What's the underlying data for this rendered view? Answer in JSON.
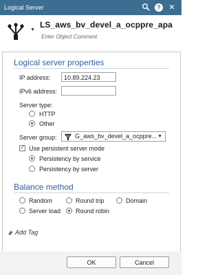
{
  "window": {
    "title": "Logical Server"
  },
  "header": {
    "object_name": "LS_aws_bv_devel_a_ocppre_apa",
    "comment_placeholder": "Enter Object Comment"
  },
  "properties": {
    "section_title": "Logical server properties",
    "ip_label": "IP address:",
    "ip_value": "10.89.224.23",
    "ipv6_label": "IPv6 address:",
    "ipv6_value": "",
    "server_type_label": "Server type:",
    "server_type_options": [
      "HTTP",
      "Other"
    ],
    "server_type_selected": "Other",
    "server_group_label": "Server group:",
    "server_group_value": "G_aws_bv_devel_a_ocppre...",
    "persistent_label": "Use persistent server mode",
    "persistent_checked": true,
    "persistency_options": [
      "Persistency by service",
      "Persistency by server"
    ],
    "persistency_selected": "Persistency by service"
  },
  "balance": {
    "section_title": "Balance method",
    "options": [
      "Random",
      "Round trip",
      "Domain",
      "Server load",
      "Round robin"
    ],
    "selected": "Round robin"
  },
  "tags": {
    "add_label": "Add Tag"
  },
  "buttons": {
    "ok": "OK",
    "cancel": "Cancel"
  },
  "colors": {
    "titlebar": "#3c6e91",
    "section_title": "#2b5f9e"
  }
}
